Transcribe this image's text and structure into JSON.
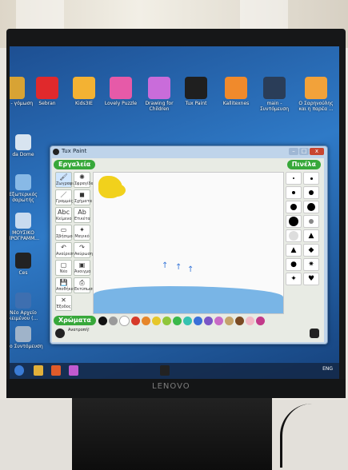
{
  "desktop": {
    "icons": [
      {
        "label": "Φήκες -\nγόμωση",
        "icon": "folder-icon",
        "color": "#d8a334"
      },
      {
        "label": "Sebran",
        "icon": "heart-icon",
        "color": "#e0292c"
      },
      {
        "label": "Kids3IE",
        "icon": "mascot-icon",
        "color": "#f3b233"
      },
      {
        "label": "Lovely Puzzle",
        "icon": "puzzle-icon",
        "color": "#e65aa8"
      },
      {
        "label": "Drawing for Children",
        "icon": "paint-icon",
        "color": "#c96cda"
      },
      {
        "label": "Tux Paint",
        "icon": "tux-icon",
        "color": "#1f1f1f"
      },
      {
        "label": "Kallitexnes",
        "icon": "artist-icon",
        "color": "#f08a2c"
      },
      {
        "label": "main - Συντόμευση",
        "icon": "feather-icon",
        "color": "#2a3d58"
      },
      {
        "label": "Ο Σαρηνούλης και η παρέα ...",
        "icon": "witch-icon",
        "color": "#f2a23a"
      }
    ],
    "left_icons": [
      {
        "label": "da Dome",
        "icon": "app-icon",
        "color": "#d8e4f0"
      },
      {
        "label": "Εξωτερικός σαρωτής",
        "icon": "computer-icon",
        "color": "#88b9e6"
      },
      {
        "label": "ΜΟΥΣΙΚΟ ΠΡΟΓΡΑΜΜ...",
        "icon": "document-icon",
        "color": "#c9dbef"
      },
      {
        "label": "Ces",
        "icon": "tux-icon",
        "color": "#222222"
      },
      {
        "label": "Νέο Αρχείο κειμένου (...",
        "icon": "text-file-icon",
        "color": "#3e6fb0"
      },
      {
        "label": "Νέο Συντόμευση",
        "icon": "shortcut-icon",
        "color": "#9fb3c9"
      }
    ]
  },
  "window": {
    "title": "Tux Paint",
    "min": "–",
    "max": "□",
    "close": "x"
  },
  "tuxpaint": {
    "tools_header": "Εργαλεία",
    "colors_header": "Πινέλα",
    "colors_bar_label": "Χρώματα",
    "status_message": "Ανατροπή!",
    "tools": [
      {
        "label": "Ζωγραφική",
        "icon": "brush"
      },
      {
        "label": "Σφραγίδα",
        "icon": "stamp"
      },
      {
        "label": "Γραμμές",
        "icon": "line"
      },
      {
        "label": "Σχήματα",
        "icon": "shape"
      },
      {
        "label": "Κείμενο",
        "glyph": "Abc"
      },
      {
        "label": "Ετικέτα",
        "glyph": "Ab"
      },
      {
        "label": "Σβήσιμο",
        "icon": "eraser"
      },
      {
        "label": "Μαγικό",
        "icon": "magic"
      },
      {
        "label": "Αναίρεση",
        "icon": "undo"
      },
      {
        "label": "Ακύρωση",
        "icon": "redo"
      },
      {
        "label": "Νέο",
        "icon": "new"
      },
      {
        "label": "Άνοιγμα",
        "icon": "open"
      },
      {
        "label": "Αποθήκευση",
        "icon": "save"
      },
      {
        "label": "Εκτύπωση",
        "icon": "print"
      },
      {
        "label": "Έξοδος",
        "icon": "quit"
      }
    ],
    "colors": [
      "#111111",
      "#9a9a9a",
      "#ffffff",
      "#d63a2a",
      "#e6862a",
      "#e6c72a",
      "#8fc63a",
      "#3ab84a",
      "#35c2b0",
      "#3a6fd8",
      "#7a55c6",
      "#c86ac6",
      "#c4a36a",
      "#7a4a23",
      "#f2b8c6",
      "#c23a8a"
    ],
    "canvas_text": [
      "↑",
      "↑",
      "↑"
    ]
  },
  "taskbar": {
    "clock": "ENG",
    "items": [
      "start",
      "explorer",
      "media",
      "paint",
      "tux"
    ]
  },
  "monitor": {
    "brand": "LENOVO"
  }
}
